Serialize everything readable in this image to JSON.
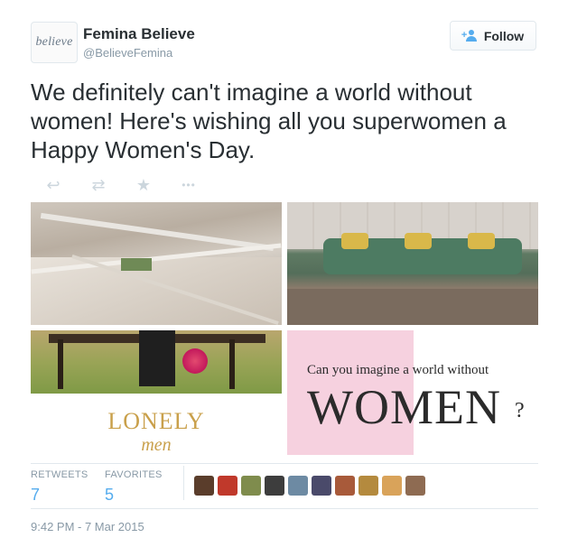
{
  "tweet": {
    "avatar_text": "believe",
    "name": "Femina Believe",
    "handle": "@BelieveFemina",
    "follow_label": "Follow",
    "text": "We definitely can't imagine a world without women! Here's wishing all you superwomen a Happy Women's Day.",
    "actions": [
      {
        "name": "reply-icon",
        "glyph": "↩"
      },
      {
        "name": "retweet-icon",
        "glyph": "⇄"
      },
      {
        "name": "favorite-icon",
        "glyph": "★"
      },
      {
        "name": "more-icon",
        "glyph": "•••"
      }
    ],
    "media": {
      "lonely_word": "LONELY",
      "men_word": "men",
      "question": "Can you imagine a world without",
      "women_word": "WOMEN",
      "qmark": "?"
    },
    "stats": {
      "retweets_label": "RETWEETS",
      "retweets": "7",
      "favorites_label": "FAVORITES",
      "favorites": "5"
    },
    "favoriter_colors": [
      "#5a3d2b",
      "#c0392b",
      "#7f8c4d",
      "#3d3d3d",
      "#6d8aa3",
      "#4a4a6a",
      "#a85a3a",
      "#b48a3e",
      "#d9a35a",
      "#8e6b52"
    ],
    "timestamp": "9:42 PM - 7 Mar 2015"
  },
  "colors": {
    "accent": "#55acee",
    "muted": "#8899a6",
    "text": "#292f33"
  }
}
